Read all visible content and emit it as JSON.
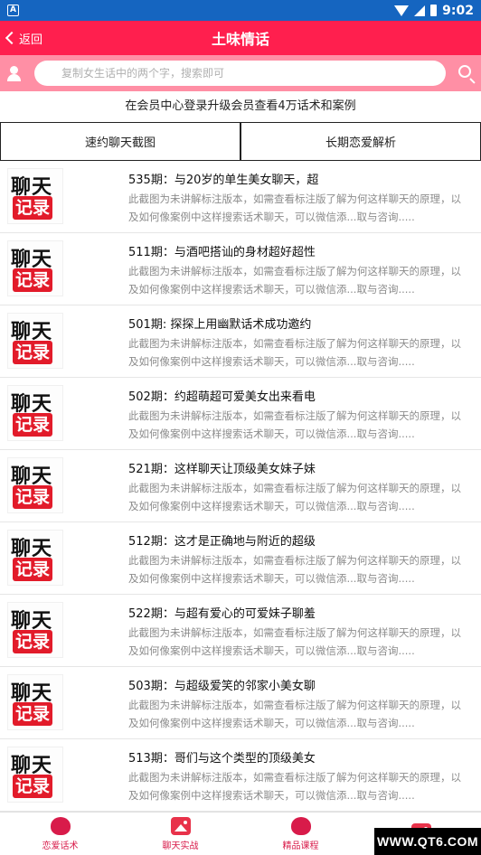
{
  "status_bar": {
    "time": "9:02",
    "left_icon": "A"
  },
  "header": {
    "back_label": "返回",
    "title": "土味情话"
  },
  "search": {
    "placeholder": "复制女生话中的两个字，搜索即可"
  },
  "notice": "在会员中心登录升级会员查看4万话术和案例",
  "tabs": [
    {
      "label": "速约聊天截图"
    },
    {
      "label": "长期恋爱解析"
    }
  ],
  "thumb": {
    "line1": "聊天",
    "line2": "记录"
  },
  "items": [
    {
      "title": "535期：与20岁的单生美女聊天，超",
      "desc": "此截图为未讲解标注版本，如需查看标注版了解为何这样聊天的原理，以及如何像案例中这样搜索话术聊天，可以微信添...取与咨询....."
    },
    {
      "title": "511期：与酒吧搭讪的身材超好超性",
      "desc": "此截图为未讲解标注版本，如需查看标注版了解为何这样聊天的原理，以及如何像案例中这样搜索话术聊天，可以微信添...取与咨询....."
    },
    {
      "title": "501期: 探探上用幽默话术成功邀约",
      "desc": "此截图为未讲解标注版本，如需查看标注版了解为何这样聊天的原理，以及如何像案例中这样搜索话术聊天，可以微信添...取与咨询....."
    },
    {
      "title": "502期：约超萌超可爱美女出来看电",
      "desc": "此截图为未讲解标注版本，如需查看标注版了解为何这样聊天的原理，以及如何像案例中这样搜索话术聊天，可以微信添...取与咨询....."
    },
    {
      "title": "521期：这样聊天让顶级美女妹子妹",
      "desc": "此截图为未讲解标注版本，如需查看标注版了解为何这样聊天的原理，以及如何像案例中这样搜索话术聊天，可以微信添...取与咨询....."
    },
    {
      "title": "512期：这才是正确地与附近的超级",
      "desc": "此截图为未讲解标注版本，如需查看标注版了解为何这样聊天的原理，以及如何像案例中这样搜索话术聊天，可以微信添...取与咨询....."
    },
    {
      "title": "522期：与超有爱心的可爱妹子聊羞",
      "desc": "此截图为未讲解标注版本，如需查看标注版了解为何这样聊天的原理，以及如何像案例中这样搜索话术聊天，可以微信添...取与咨询....."
    },
    {
      "title": "503期：与超级爱笑的邻家小美女聊",
      "desc": "此截图为未讲解标注版本，如需查看标注版了解为何这样聊天的原理，以及如何像案例中这样搜索话术聊天，可以微信添...取与咨询....."
    },
    {
      "title": "513期：哥们与这个类型的顶级美女",
      "desc": "此截图为未讲解标注版本，如需查看标注版了解为何这样聊天的原理，以及如何像案例中这样搜索话术聊天，可以微信添...取与咨询....."
    }
  ],
  "bottom_nav": [
    {
      "label": "恋爱话术",
      "icon": "rose-icon"
    },
    {
      "label": "聊天实战",
      "icon": "picture-icon"
    },
    {
      "label": "精品课程",
      "icon": "rose-icon"
    },
    {
      "label": "",
      "icon": "picture-icon"
    }
  ],
  "watermark": "WWW.QT6.COM"
}
